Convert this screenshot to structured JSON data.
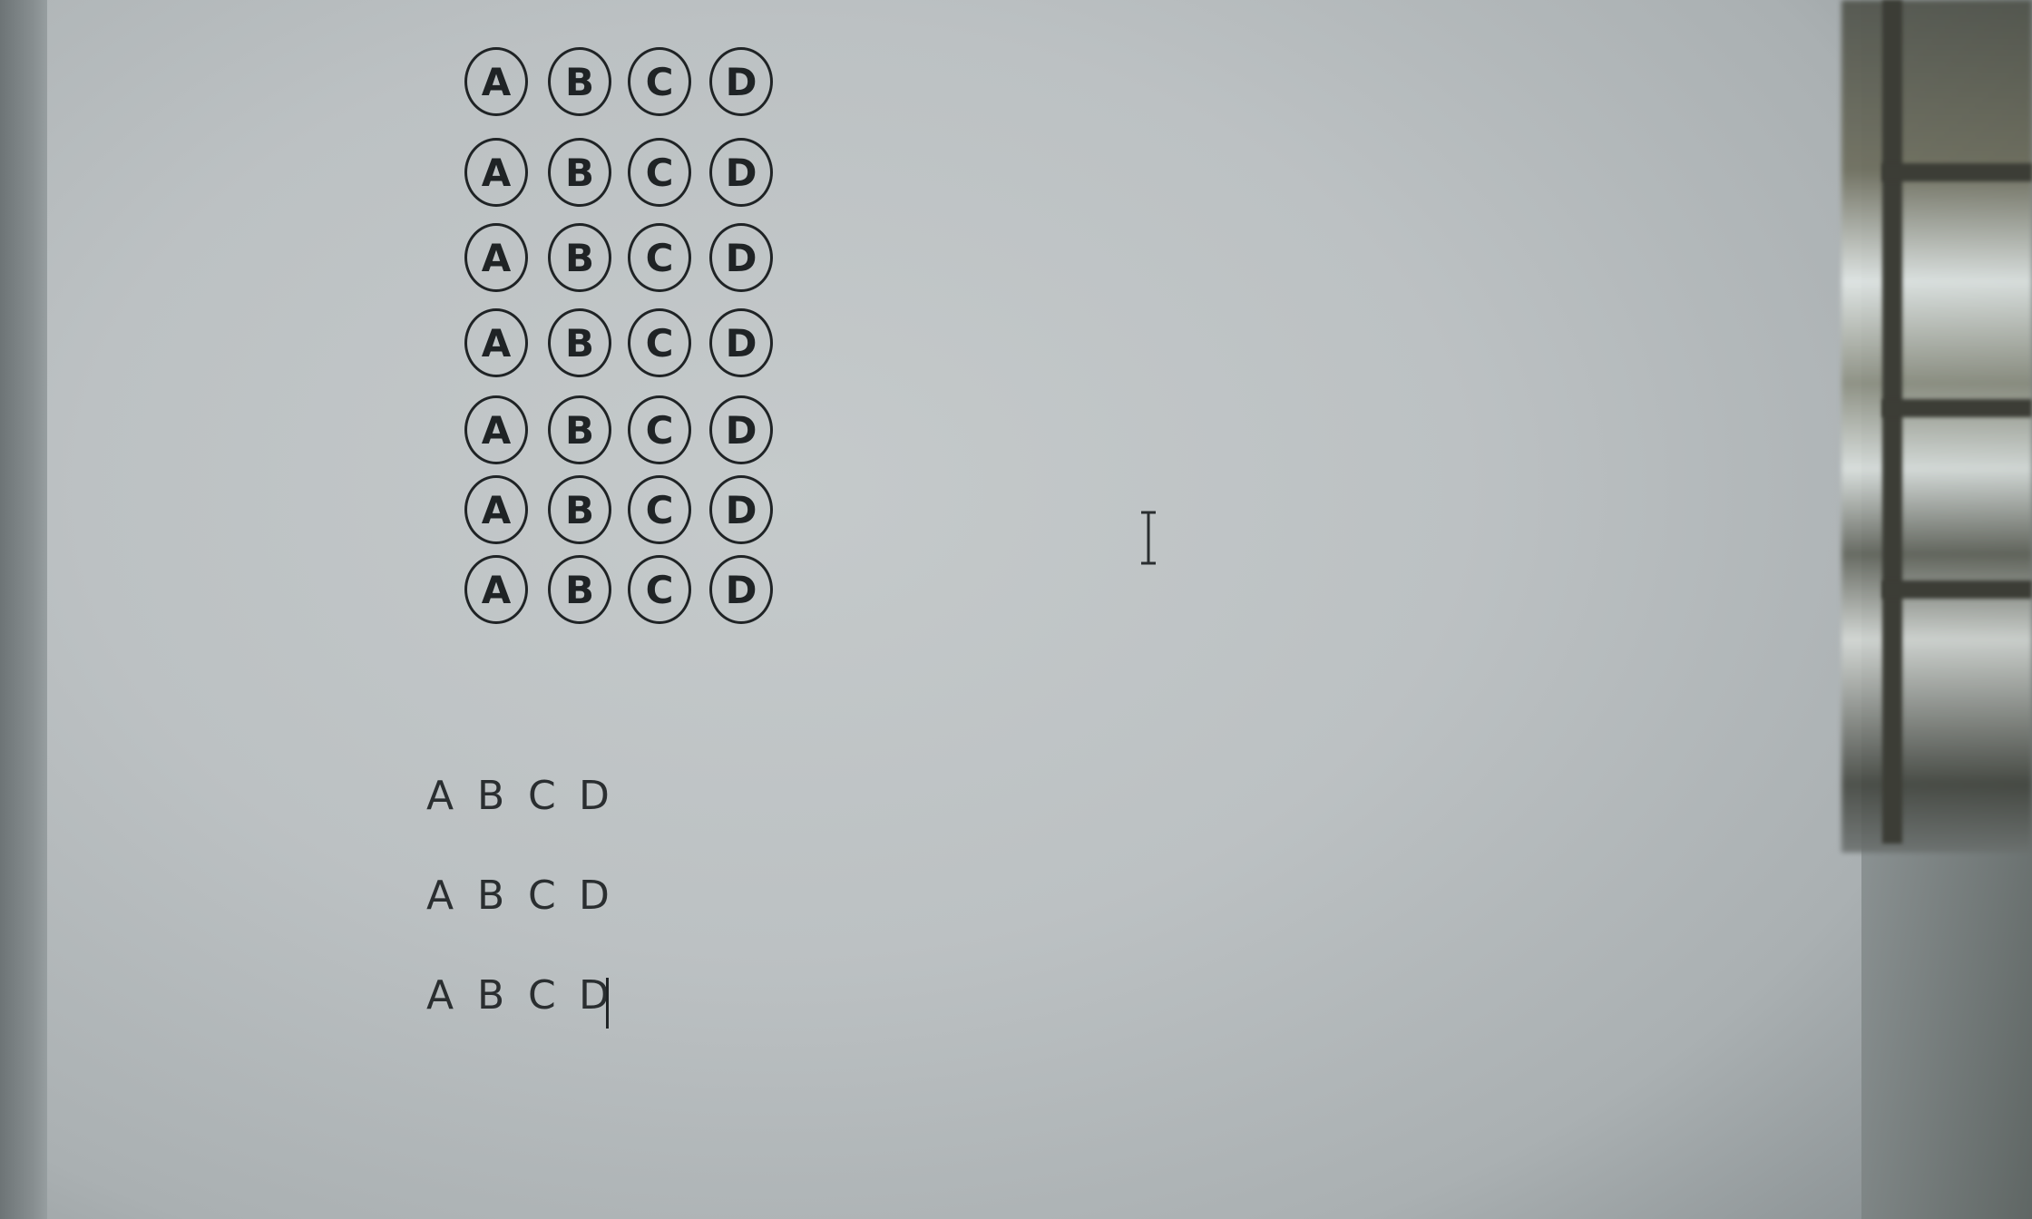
{
  "bubble_rows": [
    [
      "A",
      "B",
      "C",
      "D"
    ],
    [
      "A",
      "B",
      "C",
      "D"
    ],
    [
      "A",
      "B",
      "C",
      "D"
    ],
    [
      "A",
      "B",
      "C",
      "D"
    ],
    [
      "A",
      "B",
      "C",
      "D"
    ],
    [
      "A",
      "B",
      "C",
      "D"
    ],
    [
      "A",
      "B",
      "C",
      "D"
    ]
  ],
  "text_lines": [
    [
      "A",
      "B",
      "C",
      "D"
    ],
    [
      "A",
      "B",
      "C",
      "D"
    ],
    [
      "A",
      "B",
      "C",
      "D"
    ]
  ],
  "cursor_icon": "i-beam-cursor-icon",
  "text_caret": "text-caret"
}
